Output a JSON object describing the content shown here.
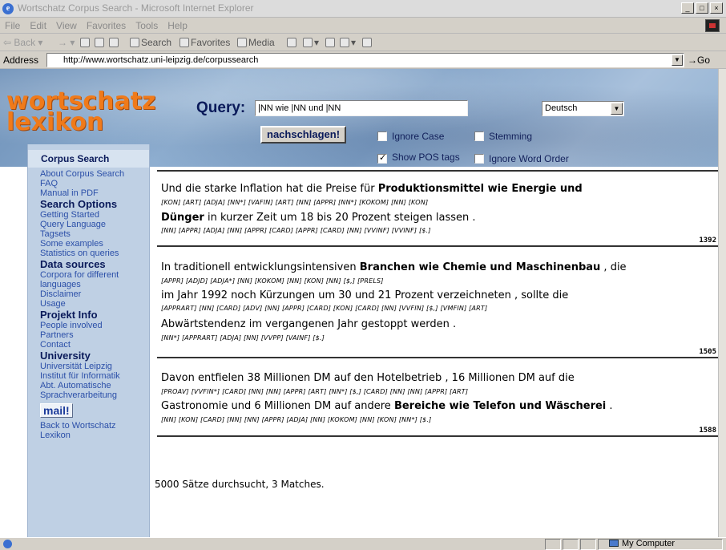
{
  "window": {
    "title": "Wortschatz Corpus Search - Microsoft Internet Explorer",
    "controls": [
      "_",
      "□",
      "×"
    ]
  },
  "menubar": [
    "File",
    "Edit",
    "View",
    "Favorites",
    "Tools",
    "Help"
  ],
  "toolbar": {
    "back": "Back",
    "forward": "→",
    "search": "Search",
    "favorites": "Favorites",
    "media": "Media"
  },
  "address": {
    "label": "Address",
    "url": "http://www.wortschatz.uni-leipzig.de/corpussearch",
    "go": "Go"
  },
  "page": {
    "logo_line1": "wortschatz",
    "logo_line2": "lexikon",
    "query_label": "Query:",
    "query_value": "|NN wie |NN und |NN",
    "language": "Deutsch",
    "submit_label": "nachschlagen!",
    "ignore_case_label": "Ignore Case",
    "ignore_case_checked": false,
    "stemming_label": "Stemming",
    "stemming_checked": false,
    "show_pos_label": "Show POS tags",
    "show_pos_checked": true,
    "ignore_word_order_label": "Ignore Word Order",
    "ignore_word_order_checked": false
  },
  "sidebar": {
    "title": "Corpus Search",
    "items": [
      {
        "type": "link",
        "text": "About Corpus Search"
      },
      {
        "type": "link",
        "text": "FAQ"
      },
      {
        "type": "link",
        "text": "Manual in PDF"
      },
      {
        "type": "head",
        "text": "Search Options"
      },
      {
        "type": "link",
        "text": "Getting Started"
      },
      {
        "type": "link",
        "text": "Query Language"
      },
      {
        "type": "link",
        "text": "Tagsets"
      },
      {
        "type": "link",
        "text": "Some examples"
      },
      {
        "type": "link",
        "text": "Statistics on queries"
      },
      {
        "type": "head",
        "text": "Data sources"
      },
      {
        "type": "link",
        "text": "Corpora for different"
      },
      {
        "type": "link",
        "text": "languages"
      },
      {
        "type": "link",
        "text": "Disclaimer"
      },
      {
        "type": "link",
        "text": "Usage"
      },
      {
        "type": "head",
        "text": "Projekt Info"
      },
      {
        "type": "link",
        "text": "People involved"
      },
      {
        "type": "link",
        "text": "Partners"
      },
      {
        "type": "link",
        "text": "Contact"
      },
      {
        "type": "head",
        "text": "University"
      },
      {
        "type": "link",
        "text": "Universität Leipzig"
      },
      {
        "type": "link",
        "text": "Institut für Informatik"
      },
      {
        "type": "link",
        "text": "Abt. Automatische"
      },
      {
        "type": "link",
        "text": "Sprachverarbeitung"
      },
      {
        "type": "mail",
        "text": "mail!"
      },
      {
        "type": "link",
        "text": "Back to Wortschatz"
      },
      {
        "type": "link",
        "text": "Lexikon"
      }
    ]
  },
  "results": {
    "separators": [
      "",
      "1392",
      "1505",
      "1588"
    ],
    "lines": [
      {
        "kind": "s",
        "text": "Und  die  starke Inflation  hat  die  Preise  für  Produktionsmittel  wie  Energie  und"
      },
      {
        "kind": "t",
        "text": "[KON] [ART]  [ADJA]     [NN*]    [VAFIN] [ART]   [NN]   [APPR]            [NN*]             [KOKOM]     [NN]     [KON]"
      },
      {
        "kind": "s",
        "text": "Dünger   in   kurzer Zeit  um    18    bis    20   Prozent steigen lassen   ."
      },
      {
        "kind": "t",
        "text": "   [NN]      [APPR]  [ADJA]   [NN] [APPR] [CARD]  [APPR] [CARD]    [NN]      [VVINF]   [VVINF]   [$.]"
      },
      {
        "kind": "s",
        "text": "  In   traditionell entwicklungsintensiven Branchen  wie  Chemie und Maschinenbau  ,   die"
      },
      {
        "kind": "t",
        "text": "[APPR]    [ADJD]                 [ADJA*]                   [NN]       [KOKOM]     [NN]     [KON]              [NN]              [$,]  [PRELS]"
      },
      {
        "kind": "s",
        "text": "  im    Jahr 1992 noch Kürzungen  um    30    und    21  Prozent verzeichneten  ,  sollte  die"
      },
      {
        "kind": "t",
        "text": "[APPRART] [NN] [CARD] [ADV]        [NN]        [APPR] [CARD] [KON] [CARD]     [NN]              [VVFIN]           [$,] [VMFIN] [ART]"
      },
      {
        "kind": "s",
        "text": "Abwärtstendenz   im    vergangenen Jahr gestoppt werden  ."
      },
      {
        "kind": "t",
        "text": "        [NN*]          [APPRART]        [ADJA]          [NN]      [VVPP]      [VAINF]   [$.]"
      },
      {
        "kind": "s",
        "text": "Davon entfielen  38  Millionen DM  auf  den Hotelbetrieb  ,   16  Millionen DM  auf  die"
      },
      {
        "kind": "t",
        "text": "[PROAV]  [VVFIN*]  [CARD]       [NN]       [NN] [APPR] [ART]          [NN*]          [$,] [CARD]        [NN]        [NN] [APPR] [ART]"
      },
      {
        "kind": "s",
        "text": "Gastronomie und   6   Millionen DM  auf  andere Bereiche  wie  Telefon und Wäscherei  ."
      },
      {
        "kind": "t",
        "text": "       [NN]          [KON] [CARD]        [NN]         [NN] [APPR]   [ADJA]        [NN]         [KOKOM]     [NN]     [KON]          [NN*]        [$.]"
      }
    ],
    "summary": "5000 Sätze durchsucht, 3 Matches."
  },
  "statusbar": {
    "zone": "My Computer"
  }
}
